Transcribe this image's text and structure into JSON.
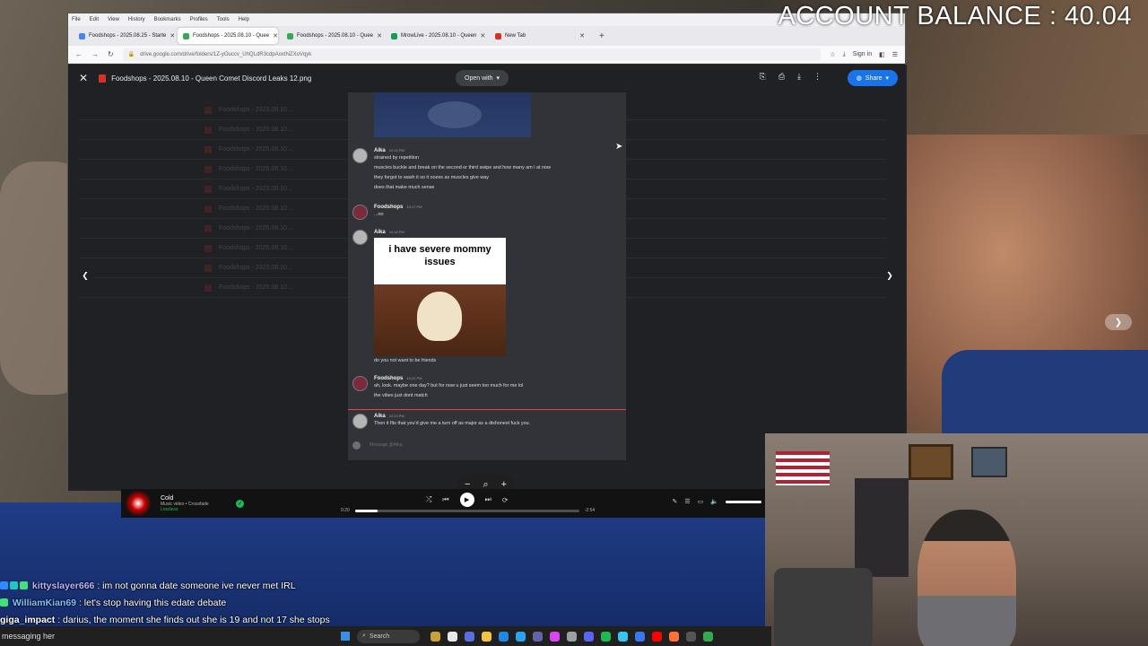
{
  "overlay": {
    "balance": "ACCOUNT BALANCE : 40.04"
  },
  "browser": {
    "menu": [
      "File",
      "Edit",
      "View",
      "History",
      "Bookmarks",
      "Profiles",
      "Tools",
      "Help"
    ],
    "tabs": [
      {
        "label": "Foodshops - 2025.08.25 - Starte",
        "color": "#4285f4",
        "active": false
      },
      {
        "label": "Foodshops - 2025.08.10 - Quee",
        "color": "#34a853",
        "active": true
      },
      {
        "label": "Foodshops - 2025.08.10 - Quee",
        "color": "#34a853",
        "active": false
      },
      {
        "label": "MrowLive - 2025.08.10 - Queen",
        "color": "#0f9d58",
        "active": false
      },
      {
        "label": "New Tab",
        "color": "#d93025",
        "active": false
      }
    ],
    "url": "drive.google.com/drive/folders/1Z-yOuccv_UhQLdR3cdpAoxtNZXoVqyk",
    "sign_in": "Sign in"
  },
  "viewer": {
    "file_title": "Foodshops - 2025.08.10 - Queen Comet Discord Leaks 12.png",
    "open_with": "Open with",
    "share": "Share",
    "bg_title": "Foodshops - 2025.08.10 ..."
  },
  "discord": {
    "messages": [
      {
        "user": "Aika",
        "time": "10:16 PM",
        "lines": [
          "strained by repetition",
          "muscles buckle and break on the second or third swipe and how many am i at now",
          "they forgot to wash it so it oozes as muscles give way",
          "does that make much sense"
        ]
      },
      {
        "user": "Foodshops",
        "time": "10:17 PM",
        "lines": [
          "...no"
        ]
      },
      {
        "user": "Aika",
        "time": "10:18 PM",
        "meme_text": "i have severe mommy issues",
        "lines_after": [
          "do you not want to be friends"
        ]
      },
      {
        "user": "Foodshops",
        "time": "10:22 PM",
        "lines": [
          "ah, look. maybe one day? but for now u just seem too much for me lol",
          "the vibes just dont match"
        ]
      },
      {
        "user": "Aika",
        "time": "10:23 PM",
        "lines": [
          "Then it fits that you'd give me a turn off as major as a dishonest fuck you."
        ]
      }
    ],
    "input_placeholder": "Message @Aika"
  },
  "player": {
    "track": "Cold",
    "subtitle": "Music video • Crossfade",
    "quality": "Lossless",
    "elapsed": "0:20",
    "remaining": "-2:54",
    "progress": 0.0993
  },
  "chat": [
    {
      "user": "kittyslayer666",
      "user_color": "#b9b6ff",
      "text": "im not gonna date someone ive never met IRL"
    },
    {
      "user": "WilliamKian69",
      "user_color": "#7dc3ff",
      "text": "let's stop having this edate debate"
    },
    {
      "user": "giga_impact",
      "user_color": "#ffffff",
      "text": "darius, the moment she finds out she is 19 and not 17 she stops"
    }
  ],
  "taskbar": {
    "preview": "messaging her",
    "search": "Search"
  }
}
